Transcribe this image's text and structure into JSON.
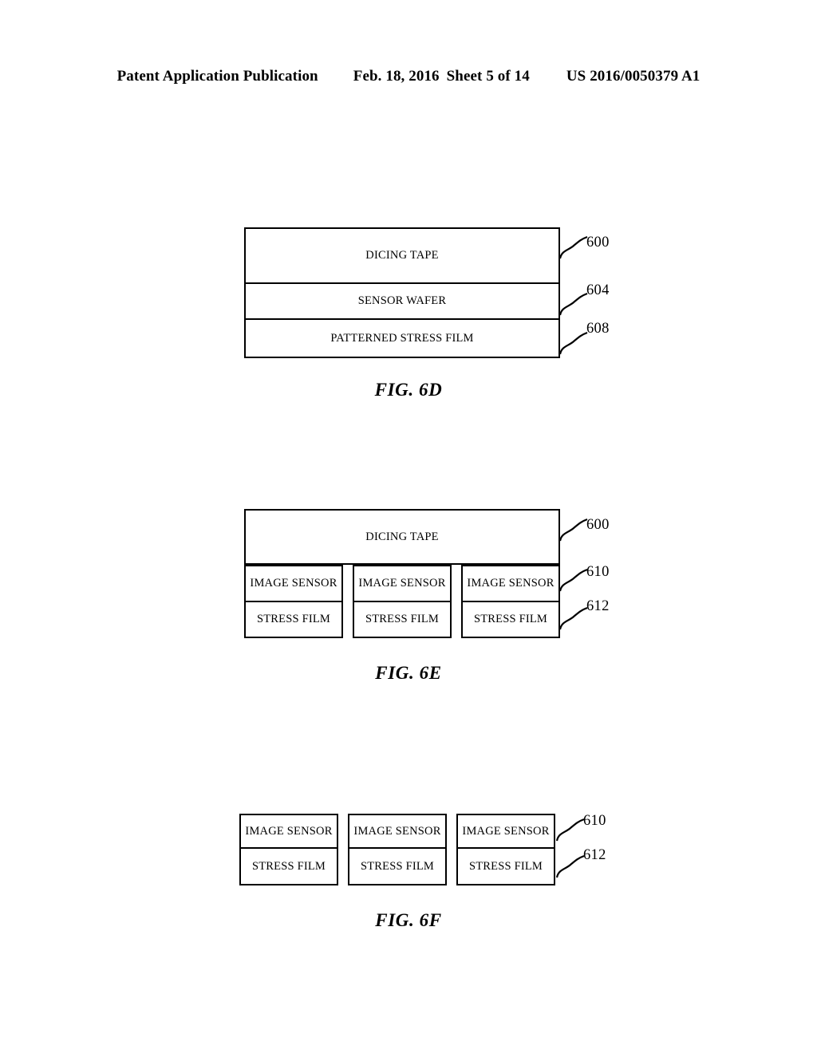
{
  "header": {
    "title": "Patent Application Publication",
    "date": "Feb. 18, 2016",
    "sheet": "Sheet 5 of 14",
    "publication_number": "US 2016/0050379 A1"
  },
  "figures": [
    {
      "caption": "FIG. 6D",
      "layers": [
        {
          "label": "DICING TAPE",
          "ref": "600"
        },
        {
          "label": "SENSOR WAFER",
          "ref": "604"
        },
        {
          "label": "PATTERNED STRESS FILM",
          "ref": "608"
        }
      ]
    },
    {
      "caption": "FIG. 6E",
      "tape": {
        "label": "DICING TAPE",
        "ref": "600"
      },
      "die_top_ref": "610",
      "die_bottom_ref": "612",
      "dies": [
        {
          "top": "IMAGE SENSOR",
          "bottom": "STRESS FILM"
        },
        {
          "top": "IMAGE SENSOR",
          "bottom": "STRESS FILM"
        },
        {
          "top": "IMAGE SENSOR",
          "bottom": "STRESS FILM"
        }
      ]
    },
    {
      "caption": "FIG. 6F",
      "die_top_ref": "610",
      "die_bottom_ref": "612",
      "dies": [
        {
          "top": "IMAGE SENSOR",
          "bottom": "STRESS FILM"
        },
        {
          "top": "IMAGE SENSOR",
          "bottom": "STRESS FILM"
        },
        {
          "top": "IMAGE SENSOR",
          "bottom": "STRESS FILM"
        }
      ]
    }
  ],
  "colors": {
    "ink": "#000000",
    "paper": "#ffffff"
  }
}
